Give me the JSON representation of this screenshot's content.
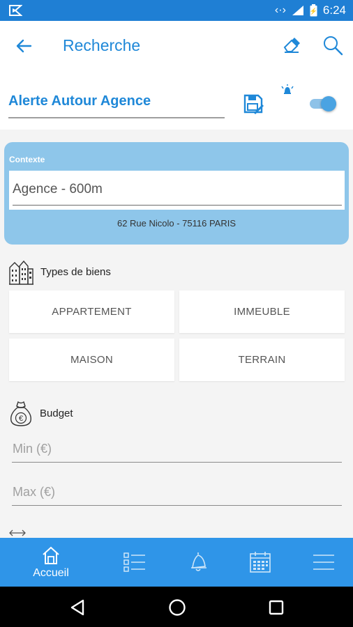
{
  "status_bar": {
    "time": "6:24"
  },
  "app_bar": {
    "title": "Recherche",
    "icons": [
      "back-arrow-icon",
      "eraser-icon",
      "search-icon"
    ]
  },
  "alert": {
    "name": "Alerte Autour Agence",
    "toggle_on": true,
    "icons": [
      "save-edit-icon",
      "bell-alarm-icon"
    ]
  },
  "context": {
    "label": "Contexte",
    "value": "Agence - 600m",
    "address": "62 Rue Nicolo  -  75116 PARIS"
  },
  "property_types": {
    "label": "Types de biens",
    "icon": "buildings-icon",
    "options": [
      {
        "label": "APPARTEMENT"
      },
      {
        "label": "IMMEUBLE"
      },
      {
        "label": "MAISON"
      },
      {
        "label": "TERRAIN"
      }
    ]
  },
  "budget": {
    "label": "Budget",
    "icon": "money-bag-euro-icon",
    "min_placeholder": "Min (€)",
    "max_placeholder": "Max (€)"
  },
  "bottom_nav": {
    "items": [
      {
        "label": "Accueil",
        "icon": "home-icon",
        "active": true
      },
      {
        "label": "",
        "icon": "checklist-icon",
        "active": false
      },
      {
        "label": "",
        "icon": "bell-icon",
        "active": false
      },
      {
        "label": "",
        "icon": "calendar-icon",
        "active": false
      },
      {
        "label": "",
        "icon": "menu-icon",
        "active": false
      }
    ]
  },
  "colors": {
    "accent": "#1f88d8",
    "status_bar": "#1f7fd4",
    "bottom_nav": "#2f95e8",
    "context_card": "#8ec6ea"
  }
}
